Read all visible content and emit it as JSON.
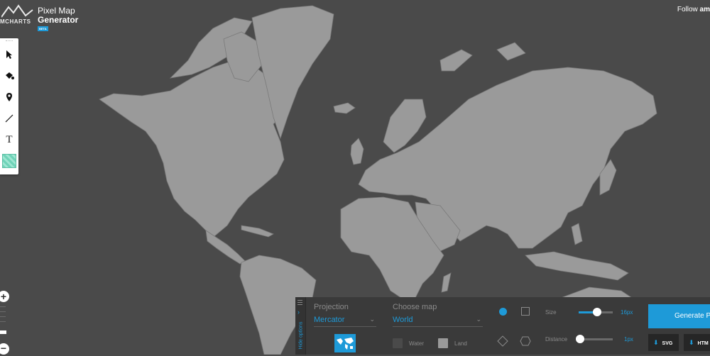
{
  "header": {
    "brand": "MCHARTS",
    "app_name_line1": "Pixel Map",
    "app_name_line2": "Generator",
    "beta_badge": "BETA",
    "follow_prefix": "Follow",
    "follow_name": "am"
  },
  "toolbar": {
    "tools": [
      {
        "name": "select",
        "icon": "cursor-arrow-icon"
      },
      {
        "name": "fill",
        "icon": "paint-bucket-icon"
      },
      {
        "name": "marker",
        "icon": "map-pin-icon"
      },
      {
        "name": "line",
        "icon": "line-icon"
      },
      {
        "name": "text",
        "icon": "text-icon",
        "glyph": "T"
      },
      {
        "name": "color",
        "icon": "color-swatch-icon"
      }
    ]
  },
  "zoom": {
    "in_glyph": "+",
    "out_glyph": "−"
  },
  "options": {
    "hide_label": "Hide options",
    "projection_label": "Projection",
    "projection_value": "Mercator",
    "map_label": "Choose map",
    "map_value": "World",
    "water_label": "Water",
    "land_label": "Land",
    "water_color": "#4a4a4a",
    "land_color": "#9a9a9a",
    "size_label": "Size",
    "size_value": "16px",
    "size_fraction": 0.55,
    "distance_label": "Distance",
    "distance_value": "1px",
    "distance_fraction": 0.05
  },
  "actions": {
    "generate_label": "Generate P",
    "svg_label": "SVG",
    "html_label": "HTM"
  },
  "colors": {
    "accent": "#1e9ad8",
    "background": "#4a4a4a",
    "land": "#9a9a9a",
    "panel": "#3a3a3a"
  }
}
